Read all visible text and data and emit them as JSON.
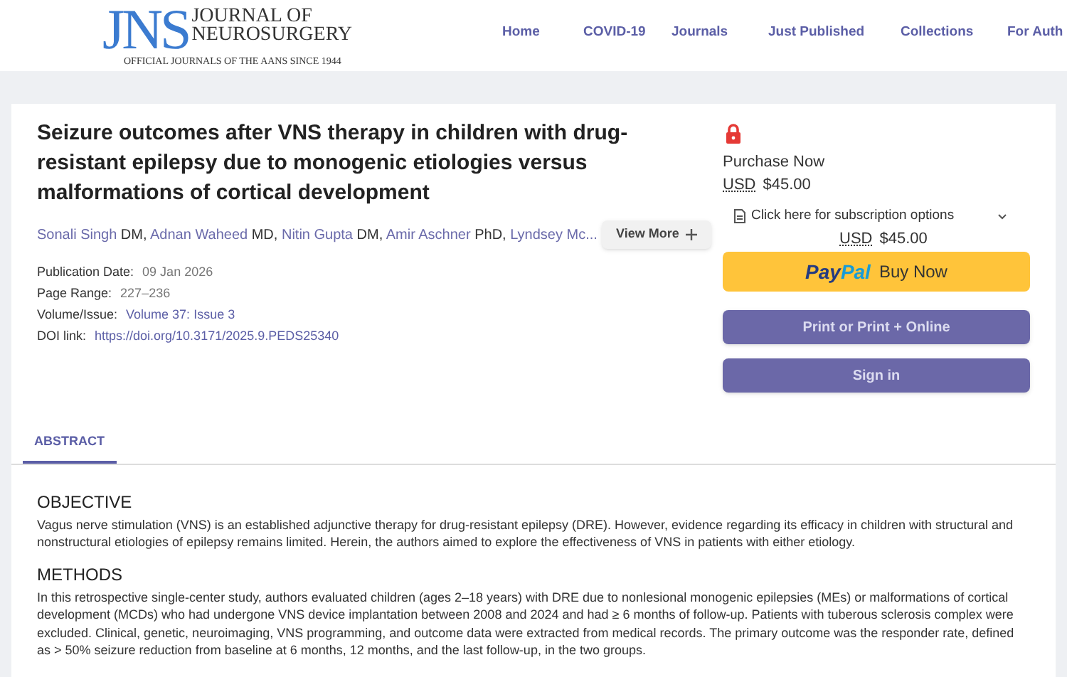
{
  "logo": {
    "mark": "JNS",
    "line_1": "JOURNAL OF",
    "line_2": "NEUROSURGERY",
    "tagline": "OFFICIAL JOURNALS OF THE AANS SINCE 1944"
  },
  "nav": [
    "Home",
    "COVID-19",
    "Journals",
    "Just Published",
    "Collections",
    "For Auth"
  ],
  "article": {
    "title": "Seizure outcomes after VNS therapy in children with drug-resistant epilepsy due to monogenic etiologies versus malformations of cortical development",
    "authors": [
      {
        "name": "Sonali Singh",
        "degree": "DM,"
      },
      {
        "name": "Adnan Waheed",
        "degree": "MD,"
      },
      {
        "name": "Nitin Gupta",
        "degree": "DM,"
      },
      {
        "name": "Amir Aschner",
        "degree": "PhD,"
      },
      {
        "name": "Lyndsey Mc..."
      }
    ],
    "view_more": "View More",
    "meta": [
      {
        "label": "Publication Date:",
        "value": "09 Jan 2026",
        "kind": "text"
      },
      {
        "label": "Page Range:",
        "value": "227–236",
        "kind": "text"
      },
      {
        "label": "Volume/Issue:",
        "value": "Volume 37: Issue 3",
        "kind": "link"
      },
      {
        "label": "DOI link:",
        "value": "https://doi.org/10.3171/2025.9.PEDS25340",
        "kind": "link"
      }
    ]
  },
  "purchase": {
    "heading": "Purchase Now",
    "currency": "USD",
    "price": "$45.00",
    "subscription": "Click here for subscription options",
    "sub_currency": "USD",
    "sub_price": "$45.00",
    "paypal_pay": "Pay",
    "paypal_pal": "Pal",
    "paypal_action": "Buy Now",
    "buttons": [
      "Print or Print + Online",
      "Sign in"
    ]
  },
  "tabs": [
    {
      "label": "ABSTRACT",
      "selected": true
    }
  ],
  "abstract": [
    {
      "heading": "OBJECTIVE",
      "text": "Vagus nerve stimulation (VNS) is an established adjunctive therapy for drug-resistant epilepsy (DRE). However, evidence regarding its efficacy in children with structural and nonstructural etiologies of epilepsy remains limited. Herein, the authors aimed to explore the effectiveness of VNS in patients with either etiology."
    },
    {
      "heading": "METHODS",
      "text": "In this retrospective single-center study, authors evaluated children (ages 2–18 years) with DRE due to nonlesional monogenic epilepsies (MEs) or malformations of cortical development (MCDs) who had undergone VNS device implantation between 2008 and 2024 and had ≥ 6 months of follow-up. Patients with tuberous sclerosis complex were excluded. Clinical, genetic, neuroimaging, VNS programming, and outcome data were extracted from medical records. The primary outcome was the responder rate, defined as > 50% seizure reduction from baseline at 6 months, 12 months, and the last follow-up, in the two groups."
    }
  ]
}
